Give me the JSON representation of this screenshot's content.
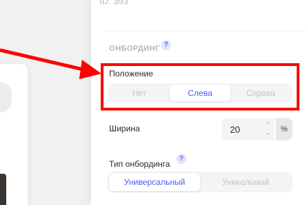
{
  "panel": {
    "id_text": "ID: 393",
    "section_title": "ОНБОРДИНГ",
    "help_glyph": "?"
  },
  "position": {
    "label": "Положение",
    "options": [
      "Нет",
      "Слева",
      "Справа"
    ],
    "selected": "Слева"
  },
  "width": {
    "label": "Ширина",
    "value": "20",
    "unit": "%"
  },
  "onboarding_type": {
    "label": "Тип онбординга",
    "options": [
      "Универсальный",
      "Уникальный"
    ],
    "selected": "Универсальный"
  },
  "colors": {
    "accent": "#4b5ee8",
    "annotation": "#ff0000"
  }
}
